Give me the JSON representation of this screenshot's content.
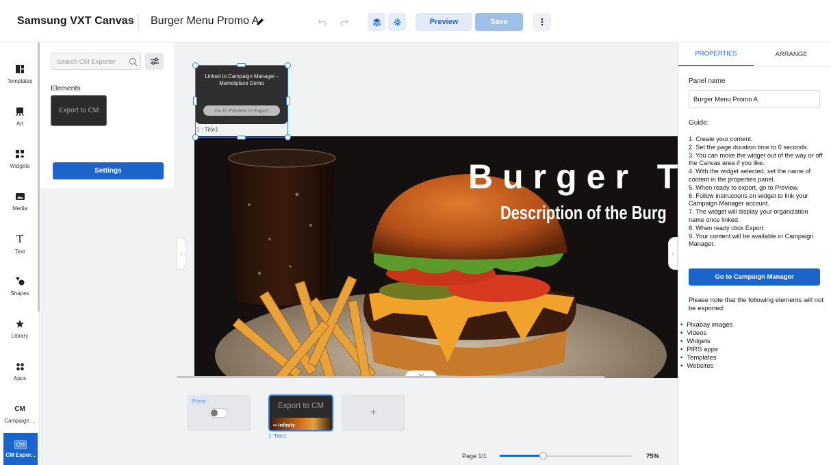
{
  "topbar": {
    "brand": "Samsung VXT Canvas",
    "document_title": "Burger Menu Promo A",
    "preview_label": "Preview",
    "save_label": "Save"
  },
  "rail": {
    "items": [
      {
        "label": "Templates",
        "icon": "templates-icon"
      },
      {
        "label": "Art",
        "icon": "art-icon"
      },
      {
        "label": "Widgets",
        "icon": "widgets-icon"
      },
      {
        "label": "Media",
        "icon": "media-icon"
      },
      {
        "label": "Text",
        "icon": "text-icon"
      },
      {
        "label": "Shapes",
        "icon": "shapes-icon"
      },
      {
        "label": "Library",
        "icon": "star-icon"
      },
      {
        "label": "Apps",
        "icon": "apps-icon"
      },
      {
        "label": "Campaign ...",
        "icon_text": "CM"
      },
      {
        "label": "CM Expor...",
        "icon_text": "CM",
        "active": true
      }
    ]
  },
  "elements_panel": {
    "search_placeholder": "Search CM Exporter",
    "section_title": "Elements",
    "element_thumb_label": "Export to CM",
    "settings_label": "Settings"
  },
  "canvas": {
    "headline": "Burger Tit",
    "subline": "Description of the Burg",
    "widget": {
      "text": "Linked to Campaign Manager - Marketplace Demo",
      "button": "Go to Preview to Export",
      "selection_label": "1 : Title1"
    }
  },
  "bottom": {
    "prime_badge": "Prime",
    "page_thumb_text": "Export to CM",
    "page_thumb_duration": "∞ Infinity",
    "page_label": "1: Title1",
    "add_label": "+",
    "pager": "Page 1/1",
    "zoom": "75%",
    "zoom_fraction": 0.33
  },
  "properties": {
    "tab_properties": "PROPERTIES",
    "tab_arrange": "ARRANGE",
    "panel_name_label": "Panel name",
    "panel_name_value": "Burger Menu Promo A",
    "guide_label": "Guide:",
    "guide_steps": [
      "1.  Create your content.",
      "2.  Set the page duration time to 0 seconds.",
      "3.  You can move the widget out of the way or off the Canvas area if you like.",
      "4.  With the widget selected, set the name of content in the properties panel.",
      "5.  When ready to export, go to Preview.",
      "6.  Follow instructions on widget to link your Campaign Manager account.",
      "7.  The widget will display your organization name once linked.",
      "8.  When ready click Export",
      "9.  Your content will be available in Campaign Manager."
    ],
    "cm_button": "Go to Campaign Manager",
    "note": "Please note that the following elements will not be exported:",
    "excluded": [
      "Pixabay images",
      "Videos",
      "Widgets",
      "PIRS apps",
      "Templates",
      "Websites"
    ]
  },
  "colors": {
    "accent": "#1b64c9",
    "selection": "#2d7be0",
    "panel_bg": "#f1f2f4"
  }
}
